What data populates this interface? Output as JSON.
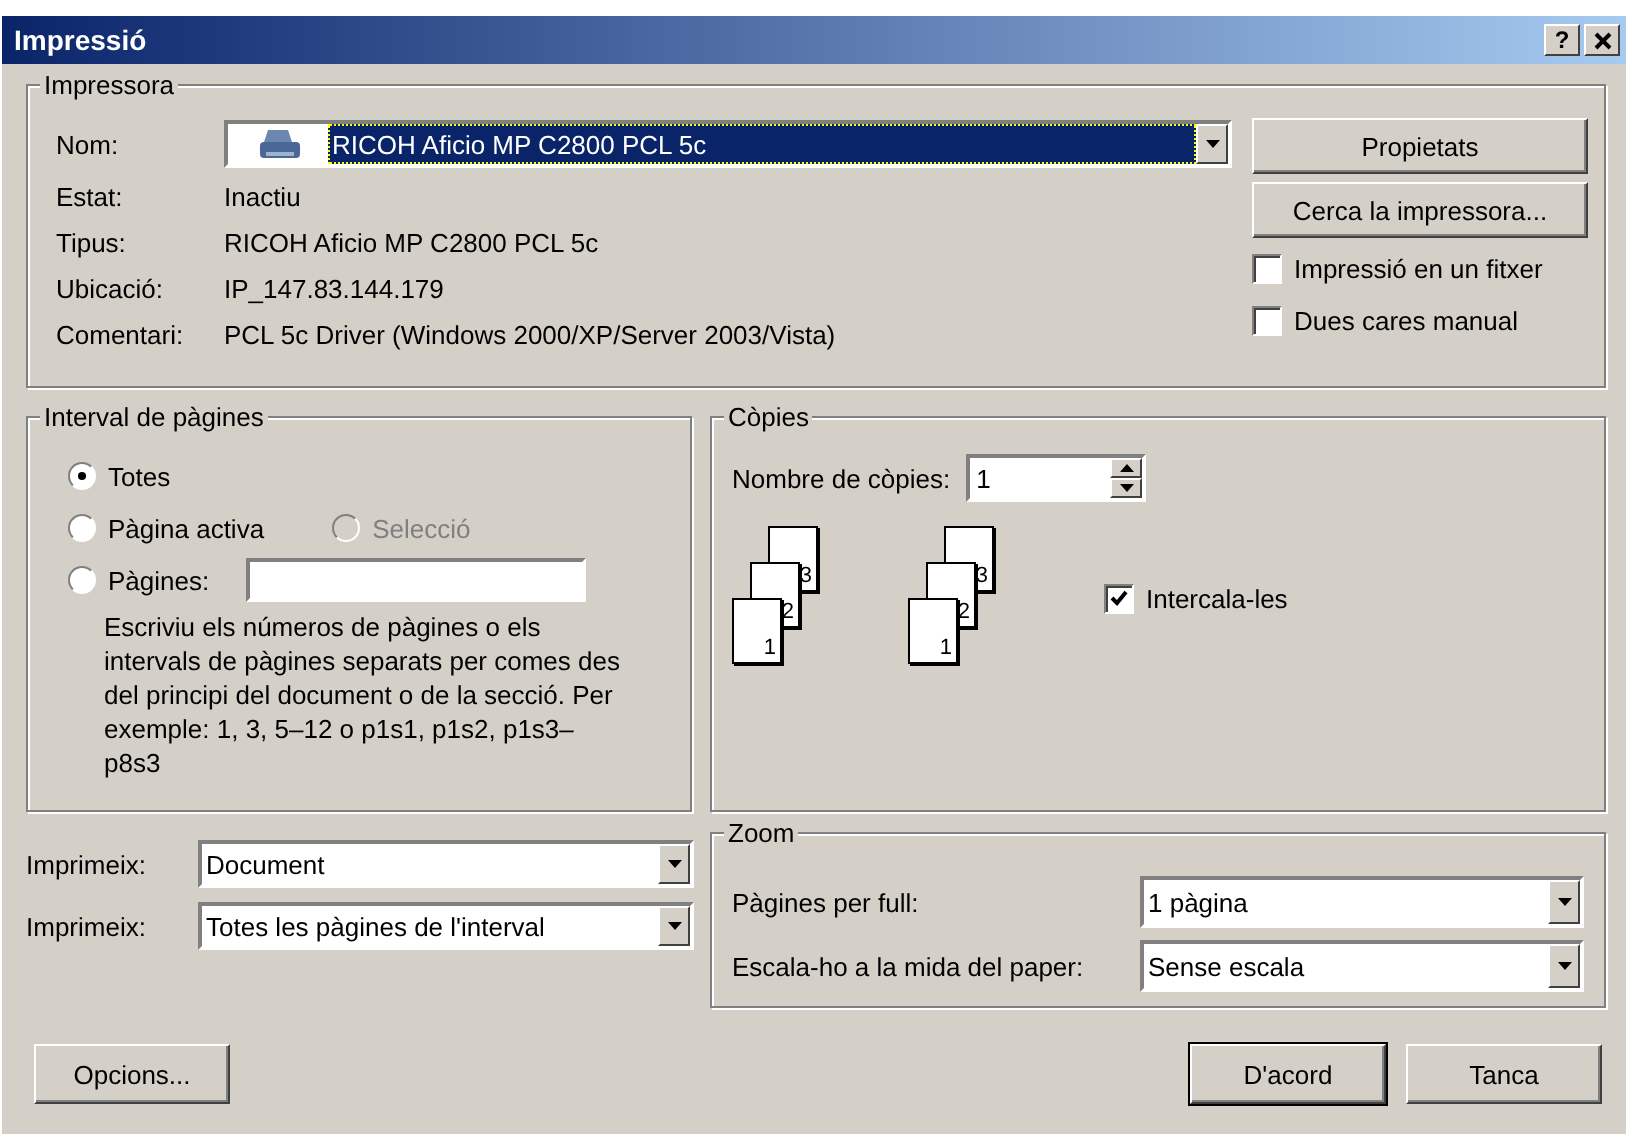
{
  "window": {
    "title": "Impressió",
    "help": "?"
  },
  "printer": {
    "group": "Impressora",
    "name_label": "Nom:",
    "name_value": "RICOH Aficio MP C2800 PCL 5c",
    "info": [
      {
        "label": "Estat:",
        "value": "Inactiu"
      },
      {
        "label": "Tipus:",
        "value": "RICOH Aficio MP C2800 PCL 5c"
      },
      {
        "label": "Ubicació:",
        "value": "IP_147.83.144.179"
      },
      {
        "label": "Comentari:",
        "value": "PCL 5c Driver (Windows 2000/XP/Server 2003/Vista)"
      }
    ],
    "buttons": [
      "Propietats",
      "Cerca la impressora..."
    ],
    "options": [
      {
        "label": "Impressió en un fitxer",
        "checked": false
      },
      {
        "label": "Dues cares manual",
        "checked": false
      }
    ]
  },
  "range": {
    "group": "Interval de pàgines",
    "rows": [
      {
        "options": [
          {
            "label": "Totes",
            "selected": true,
            "disabled": false,
            "kind": "plain"
          }
        ]
      },
      {
        "options": [
          {
            "label": "Pàgina activa",
            "selected": false,
            "disabled": false,
            "kind": "plain"
          },
          {
            "label": "Selecció",
            "selected": false,
            "disabled": true,
            "kind": "plain"
          }
        ]
      },
      {
        "options": [
          {
            "label": "Pàgines:",
            "selected": false,
            "disabled": false,
            "kind": "field"
          }
        ]
      }
    ],
    "help": "Escriviu els números de pàgines o els intervals de pàgines separats per comes des del principi del document o de la secció. Per exemple: 1, 3, 5–12 o p1s1, p1s2, p1s3–p8s3"
  },
  "copies": {
    "group": "Còpies",
    "label": "Nombre de còpies:",
    "value": "1",
    "stacks": [
      [
        "1",
        "2",
        "3"
      ],
      [
        "1",
        "2",
        "3"
      ]
    ],
    "collate": {
      "label": "Intercala-les",
      "checked": true
    }
  },
  "print_what": [
    {
      "label": "Imprimeix:",
      "value": "Document"
    },
    {
      "label": "Imprimeix:",
      "value": "Totes les pàgines de l'interval"
    }
  ],
  "zoom": {
    "group": "Zoom",
    "rows": [
      {
        "label": "Pàgines per full:",
        "value": "1 pàgina"
      },
      {
        "label": "Escala-ho a la mida del paper:",
        "value": "Sense escala"
      }
    ]
  },
  "buttons": [
    {
      "label": "Opcions...",
      "default": false
    },
    {
      "label": "D'acord",
      "default": true
    },
    {
      "label": "Tanca",
      "default": false
    }
  ]
}
